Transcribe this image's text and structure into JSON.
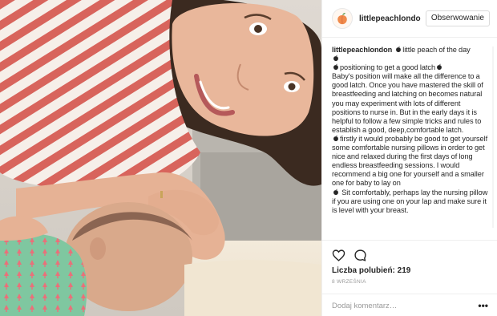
{
  "post": {
    "username": "littlepeachlondo",
    "follow_label": "Obserwowanie",
    "caption_user": "littlepeachlondon",
    "caption_paragraphs": [
      {
        "peach": true,
        "text": "little peach of the day",
        "inline": true
      },
      {
        "peach": true,
        "text": "",
        "inline": false
      },
      {
        "peach": true,
        "text": "positioning to get a good latch",
        "trail_peach": true,
        "inline": false
      },
      {
        "peach": false,
        "text": "Baby's position will make all the difference to a good latch. Once you have mastered the skill of breastfeeding and latching on becomes natural you may experiment with lots of different positions to nurse in. But in the early days it is helpful to follow a few simple tricks and rules to establish a good, deep,comfortable latch.",
        "inline": false
      },
      {
        "peach": true,
        "text": "firstly it would probably be good to get yourself some comfortable nursing pillows in order to get nice and relaxed during the first days of long endless breastfeeding sessions. I would recommend a big one for yourself and a smaller one for baby to lay on",
        "inline": false
      },
      {
        "peach": true,
        "text": " Sit comfortably, perhaps lay the nursing pillow if you are using one on your lap and make sure it is level with your breast.",
        "inline": false
      }
    ],
    "likes": "Liczba polubień: 219",
    "date": "8 WRZEŚNIA",
    "comment_placeholder": "Dodaj komentarz…",
    "more_label": "•••"
  },
  "icons": {
    "avatar": "peach-logo-icon",
    "like": "heart-icon",
    "comment": "comment-bubble-icon",
    "caption_emoji": "peach-emoji-icon",
    "more": "more-options-icon"
  },
  "colors": {
    "text": "#262626",
    "muted": "#999999",
    "border": "#efefef",
    "peach": "#f08a4b",
    "stripe_red": "#d9635c",
    "stripe_white": "#f7f1ec"
  }
}
